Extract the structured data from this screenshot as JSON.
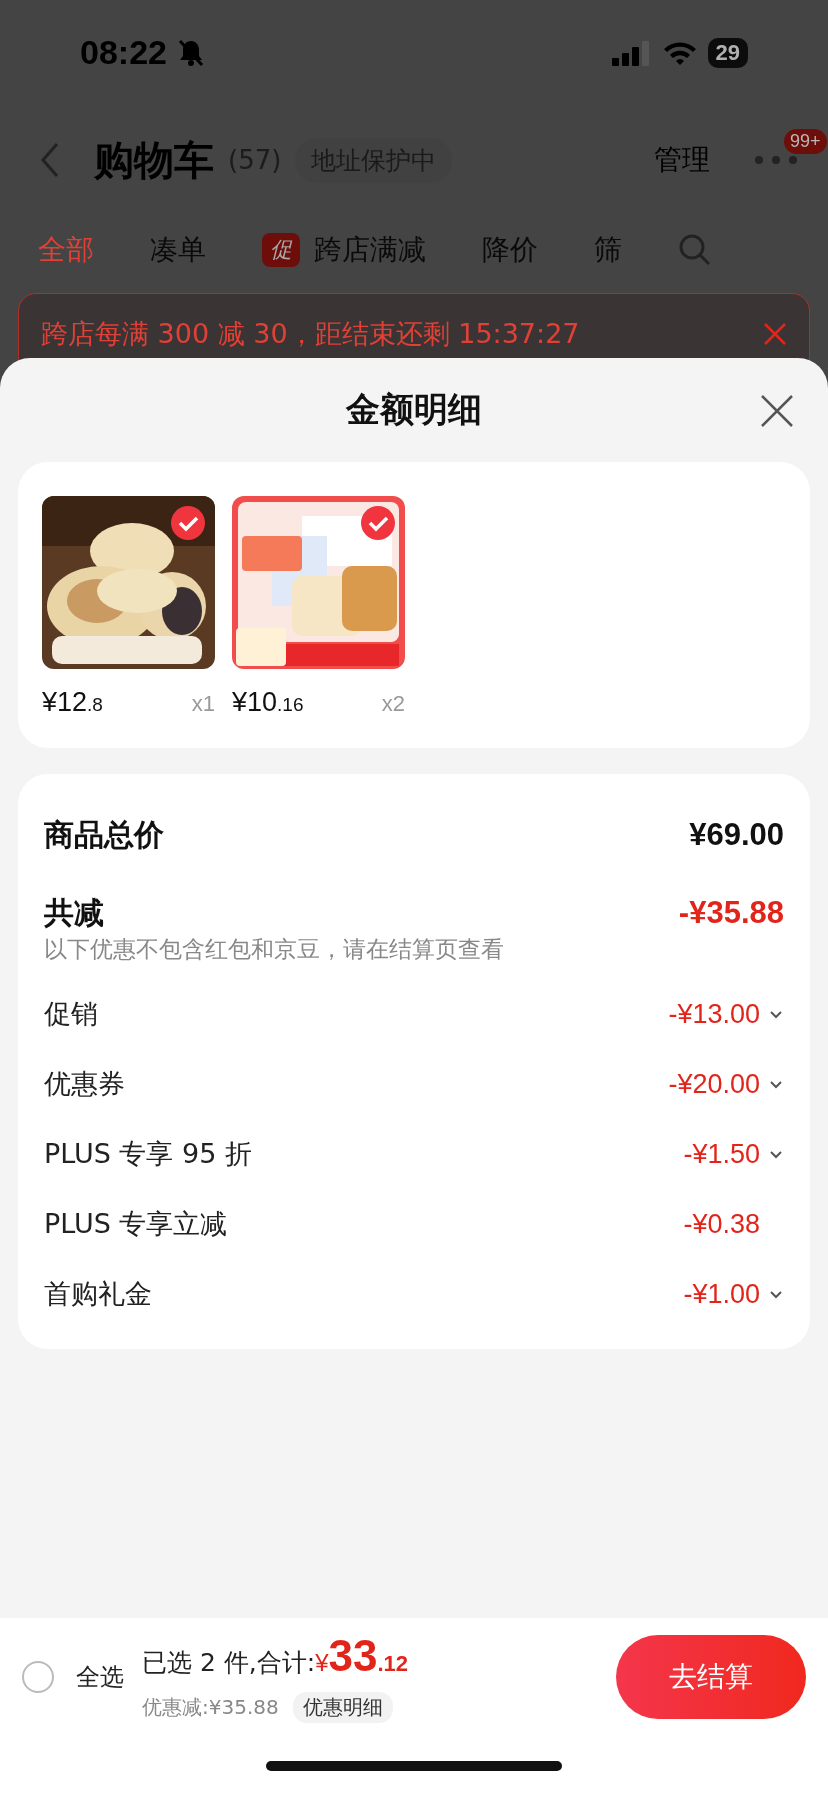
{
  "status_bar": {
    "time": "08:22",
    "battery": "29"
  },
  "header": {
    "title": "购物车",
    "count": "(57)",
    "address_tag": "地址保护中",
    "manage": "管理",
    "more_badge": "99+"
  },
  "tabs": [
    {
      "label": "全部",
      "selected": true
    },
    {
      "label": "凑单",
      "selected": false
    },
    {
      "label": "跨店满减",
      "badge": "促",
      "selected": false
    },
    {
      "label": "降价",
      "selected": false
    },
    {
      "label": "筛",
      "selected": false
    }
  ],
  "banner": {
    "text": "跨店每满 300 减 30，距结束还剩 15:37:27"
  },
  "sheet": {
    "title": "金额明细",
    "products": [
      {
        "kind": "picture",
        "checked": true,
        "price_int": "¥12",
        "price_dec": ".8",
        "quantity": "x1"
      },
      {
        "kind": "picture",
        "checked": true,
        "price_int": "¥10",
        "price_dec": ".16",
        "quantity": "x2"
      }
    ],
    "summary": [
      {
        "label": "商品总价",
        "amount": "¥69.00",
        "kind": "total"
      },
      {
        "label": "共减",
        "amount": "-¥35.88",
        "kind": "discount",
        "note": "以下优惠不包含红包和京豆，请在结算页查看"
      }
    ],
    "details": [
      {
        "label": "促销",
        "amount": "-¥13.00",
        "expandable": true
      },
      {
        "label": "优惠券",
        "amount": "-¥20.00",
        "expandable": true
      },
      {
        "label": "PLUS 专享 95 折",
        "amount": "-¥1.50",
        "expandable": true
      },
      {
        "label": "PLUS 专享立减",
        "amount": "-¥0.38",
        "expandable": false
      },
      {
        "label": "首购礼金",
        "amount": "-¥1.00",
        "expandable": true
      }
    ]
  },
  "bottom_bar": {
    "select_all": {
      "label": "全选",
      "checked": false
    },
    "selected_text": "已选 2 件,合计:",
    "total_symbol": "¥",
    "total_int": "33",
    "total_dec": ".12",
    "saved": "优惠减:¥35.88",
    "details_link": "优惠明细",
    "checkout": "去结算"
  }
}
